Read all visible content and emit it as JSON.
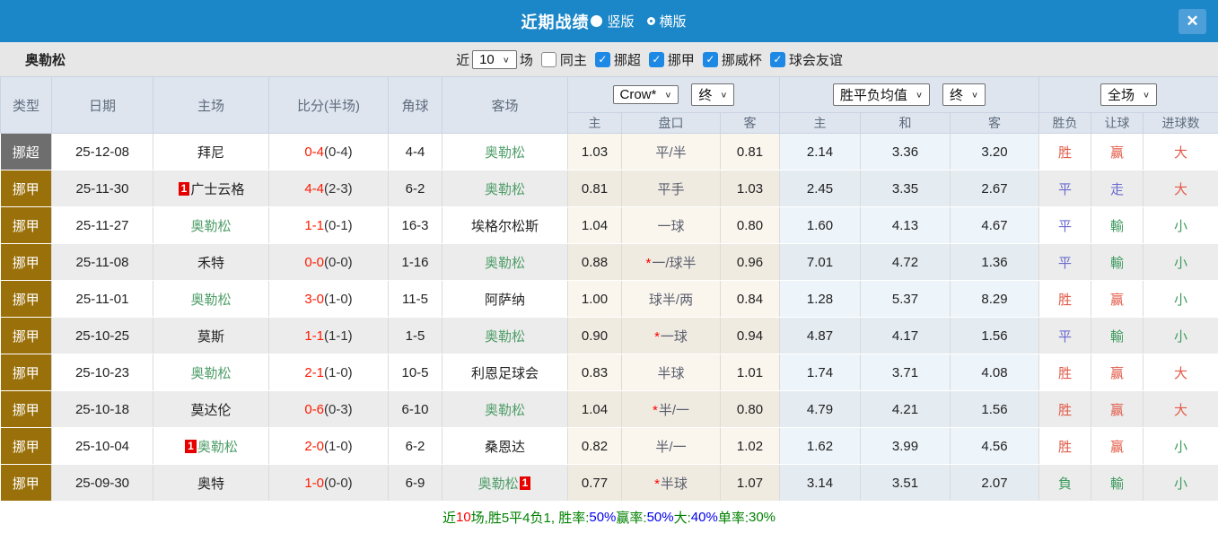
{
  "header": {
    "title": "近期战绩",
    "radio_vertical": "竖版",
    "radio_horizontal": "横版",
    "close_glyph": "✕"
  },
  "filters": {
    "team": "奥勒松",
    "near_label": "近",
    "near_value": "10",
    "games_label": "场",
    "same_host_label": "同主",
    "leagues": [
      "挪超",
      "挪甲",
      "挪威杯",
      "球会友谊"
    ]
  },
  "table": {
    "selects": {
      "bookmaker": "Crow*",
      "bookmaker_time": "终",
      "avg_type": "胜平负均值",
      "avg_time": "终",
      "scope": "全场"
    },
    "columns": {
      "type": "类型",
      "date": "日期",
      "home": "主场",
      "score": "比分(半场)",
      "corner": "角球",
      "away": "客场",
      "odds_home": "主",
      "handicap": "盘口",
      "odds_away": "客",
      "avg_home": "主",
      "avg_draw": "和",
      "avg_away": "客",
      "result": "胜负",
      "letgoal": "让球",
      "goals": "进球数"
    },
    "rows": [
      {
        "type": "挪超",
        "type_style": "chao",
        "date": "25-12-08",
        "home": {
          "name": "拜尼",
          "green": false,
          "badge": null
        },
        "score": {
          "ft": "0-4",
          "ht": "(0-4)"
        },
        "corner": "4-4",
        "away": {
          "name": "奥勒松",
          "green": true,
          "badge": null
        },
        "crown": {
          "home": "1.03",
          "star": false,
          "handicap": "平/半",
          "away": "0.81"
        },
        "avg": {
          "home": "2.14",
          "draw": "3.36",
          "away": "3.20"
        },
        "result": {
          "text": "胜",
          "cls": "red"
        },
        "letgoal": {
          "text": "赢",
          "cls": "red"
        },
        "goals": {
          "text": "大",
          "cls": "red"
        }
      },
      {
        "type": "挪甲",
        "type_style": "jia",
        "date": "25-11-30",
        "home": {
          "name": "广士云格",
          "green": false,
          "badge": "1"
        },
        "score": {
          "ft": "4-4",
          "ht": "(2-3)"
        },
        "corner": "6-2",
        "away": {
          "name": "奥勒松",
          "green": true,
          "badge": null
        },
        "crown": {
          "home": "0.81",
          "star": false,
          "handicap": "平手",
          "away": "1.03"
        },
        "avg": {
          "home": "2.45",
          "draw": "3.35",
          "away": "2.67"
        },
        "result": {
          "text": "平",
          "cls": "blue-t"
        },
        "letgoal": {
          "text": "走",
          "cls": "blue-t"
        },
        "goals": {
          "text": "大",
          "cls": "red"
        }
      },
      {
        "type": "挪甲",
        "type_style": "jia",
        "date": "25-11-27",
        "home": {
          "name": "奥勒松",
          "green": true,
          "badge": null
        },
        "score": {
          "ft": "1-1",
          "ht": "(0-1)"
        },
        "corner": "16-3",
        "away": {
          "name": "埃格尔松斯",
          "green": false,
          "badge": null
        },
        "crown": {
          "home": "1.04",
          "star": false,
          "handicap": "一球",
          "away": "0.80"
        },
        "avg": {
          "home": "1.60",
          "draw": "4.13",
          "away": "4.67"
        },
        "result": {
          "text": "平",
          "cls": "blue-t"
        },
        "letgoal": {
          "text": "輸",
          "cls": "green-t"
        },
        "goals": {
          "text": "小",
          "cls": "green-t"
        }
      },
      {
        "type": "挪甲",
        "type_style": "jia",
        "date": "25-11-08",
        "home": {
          "name": "禾特",
          "green": false,
          "badge": null
        },
        "score": {
          "ft": "0-0",
          "ht": "(0-0)"
        },
        "corner": "1-16",
        "away": {
          "name": "奥勒松",
          "green": true,
          "badge": null
        },
        "crown": {
          "home": "0.88",
          "star": true,
          "handicap": "一/球半",
          "away": "0.96"
        },
        "avg": {
          "home": "7.01",
          "draw": "4.72",
          "away": "1.36"
        },
        "result": {
          "text": "平",
          "cls": "blue-t"
        },
        "letgoal": {
          "text": "輸",
          "cls": "green-t"
        },
        "goals": {
          "text": "小",
          "cls": "green-t"
        }
      },
      {
        "type": "挪甲",
        "type_style": "jia",
        "date": "25-11-01",
        "home": {
          "name": "奥勒松",
          "green": true,
          "badge": null
        },
        "score": {
          "ft": "3-0",
          "ht": "(1-0)"
        },
        "corner": "11-5",
        "away": {
          "name": "阿萨纳",
          "green": false,
          "badge": null
        },
        "crown": {
          "home": "1.00",
          "star": false,
          "handicap": "球半/两",
          "away": "0.84"
        },
        "avg": {
          "home": "1.28",
          "draw": "5.37",
          "away": "8.29"
        },
        "result": {
          "text": "胜",
          "cls": "red"
        },
        "letgoal": {
          "text": "赢",
          "cls": "red"
        },
        "goals": {
          "text": "小",
          "cls": "green-t"
        }
      },
      {
        "type": "挪甲",
        "type_style": "jia",
        "date": "25-10-25",
        "home": {
          "name": "莫斯",
          "green": false,
          "badge": null
        },
        "score": {
          "ft": "1-1",
          "ht": "(1-1)"
        },
        "corner": "1-5",
        "away": {
          "name": "奥勒松",
          "green": true,
          "badge": null
        },
        "crown": {
          "home": "0.90",
          "star": true,
          "handicap": "一球",
          "away": "0.94"
        },
        "avg": {
          "home": "4.87",
          "draw": "4.17",
          "away": "1.56"
        },
        "result": {
          "text": "平",
          "cls": "blue-t"
        },
        "letgoal": {
          "text": "輸",
          "cls": "green-t"
        },
        "goals": {
          "text": "小",
          "cls": "green-t"
        }
      },
      {
        "type": "挪甲",
        "type_style": "jia",
        "date": "25-10-23",
        "home": {
          "name": "奥勒松",
          "green": true,
          "badge": null
        },
        "score": {
          "ft": "2-1",
          "ht": "(1-0)"
        },
        "corner": "10-5",
        "away": {
          "name": "利恩足球会",
          "green": false,
          "badge": null
        },
        "crown": {
          "home": "0.83",
          "star": false,
          "handicap": "半球",
          "away": "1.01"
        },
        "avg": {
          "home": "1.74",
          "draw": "3.71",
          "away": "4.08"
        },
        "result": {
          "text": "胜",
          "cls": "red"
        },
        "letgoal": {
          "text": "赢",
          "cls": "red"
        },
        "goals": {
          "text": "大",
          "cls": "red"
        }
      },
      {
        "type": "挪甲",
        "type_style": "jia",
        "date": "25-10-18",
        "home": {
          "name": "莫达伦",
          "green": false,
          "badge": null
        },
        "score": {
          "ft": "0-6",
          "ht": "(0-3)"
        },
        "corner": "6-10",
        "away": {
          "name": "奥勒松",
          "green": true,
          "badge": null
        },
        "crown": {
          "home": "1.04",
          "star": true,
          "handicap": "半/一",
          "away": "0.80"
        },
        "avg": {
          "home": "4.79",
          "draw": "4.21",
          "away": "1.56"
        },
        "result": {
          "text": "胜",
          "cls": "red"
        },
        "letgoal": {
          "text": "赢",
          "cls": "red"
        },
        "goals": {
          "text": "大",
          "cls": "red"
        }
      },
      {
        "type": "挪甲",
        "type_style": "jia",
        "date": "25-10-04",
        "home": {
          "name": "奥勒松",
          "green": true,
          "badge": "1"
        },
        "score": {
          "ft": "2-0",
          "ht": "(1-0)"
        },
        "corner": "6-2",
        "away": {
          "name": "桑恩达",
          "green": false,
          "badge": null
        },
        "crown": {
          "home": "0.82",
          "star": false,
          "handicap": "半/一",
          "away": "1.02"
        },
        "avg": {
          "home": "1.62",
          "draw": "3.99",
          "away": "4.56"
        },
        "result": {
          "text": "胜",
          "cls": "red"
        },
        "letgoal": {
          "text": "赢",
          "cls": "red"
        },
        "goals": {
          "text": "小",
          "cls": "green-t"
        }
      },
      {
        "type": "挪甲",
        "type_style": "jia",
        "date": "25-09-30",
        "home": {
          "name": "奥特",
          "green": false,
          "badge": null
        },
        "score": {
          "ft": "1-0",
          "ht": "(0-0)"
        },
        "corner": "6-9",
        "away": {
          "name": "奥勒松",
          "green": true,
          "badge": "1"
        },
        "crown": {
          "home": "0.77",
          "star": true,
          "handicap": "半球",
          "away": "1.07"
        },
        "avg": {
          "home": "3.14",
          "draw": "3.51",
          "away": "2.07"
        },
        "result": {
          "text": "負",
          "cls": "green-t"
        },
        "letgoal": {
          "text": "輸",
          "cls": "green-t"
        },
        "goals": {
          "text": "小",
          "cls": "green-t"
        }
      }
    ]
  },
  "footer": {
    "segments": [
      {
        "text": "近",
        "color": "#008000"
      },
      {
        "text": "10",
        "color": "#ff0000"
      },
      {
        "text": "场,胜5平4负1, 胜率:",
        "color": "#008000"
      },
      {
        "text": "50%",
        "color": "#0000ee"
      },
      {
        "text": " 赢率:",
        "color": "#008000"
      },
      {
        "text": "50%",
        "color": "#0000ee"
      },
      {
        "text": " 大:",
        "color": "#008000"
      },
      {
        "text": "40%",
        "color": "#0000ee"
      },
      {
        "text": " 单率:",
        "color": "#008000"
      },
      {
        "text": "30%",
        "color": "#008000"
      }
    ]
  },
  "colors": {
    "titlebar_bg": "#1b87c8",
    "close_bg": "#4d9fd9",
    "filterbar_bg": "#e7e7e7",
    "checkbox_checked": "#1e88e5",
    "header_bg": "#dee5ef",
    "type_chao_bg": "#6e6e6e",
    "type_jia_bg": "#99700a",
    "score_red": "#ff1a00",
    "team_green": "#4e9d68",
    "result_red": "#e25a47",
    "result_blue": "#6a6ace",
    "result_green": "#3d9b5f"
  }
}
